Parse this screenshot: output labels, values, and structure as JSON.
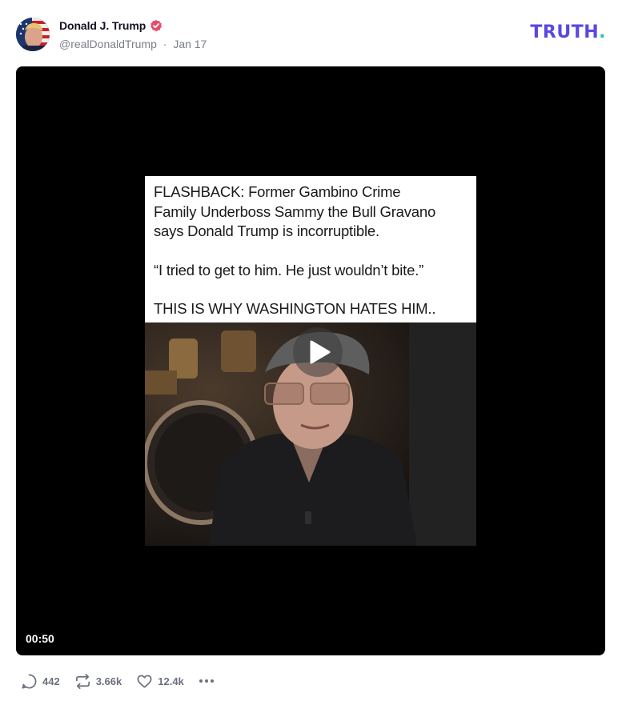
{
  "post": {
    "display_name": "Donald J. Trump",
    "handle": "@realDonaldTrump",
    "separator": "·",
    "date": "Jan 17",
    "verified_icon": "verified-badge-icon",
    "brand": {
      "text": "TRUTH",
      "dot": ".",
      "color": "#5a48e0",
      "dot_color": "#20c5b4"
    }
  },
  "video": {
    "caption_lines": [
      "FLASHBACK: Former Gambino Crime",
      "Family Underboss Sammy the Bull Gravano",
      "says Donald Trump is incorruptible."
    ],
    "quote": "“I tried to get to him. He just wouldn’t bite.”",
    "tagline": "THIS IS WHY WASHINGTON HATES HIM..",
    "duration": "00:50",
    "play_icon": "play-icon"
  },
  "actions": {
    "replies": {
      "icon": "reply-icon",
      "count": "442"
    },
    "retruths": {
      "icon": "retruth-icon",
      "count": "3.66k"
    },
    "likes": {
      "icon": "heart-icon",
      "count": "12.4k"
    },
    "more": {
      "icon": "more-icon"
    }
  }
}
